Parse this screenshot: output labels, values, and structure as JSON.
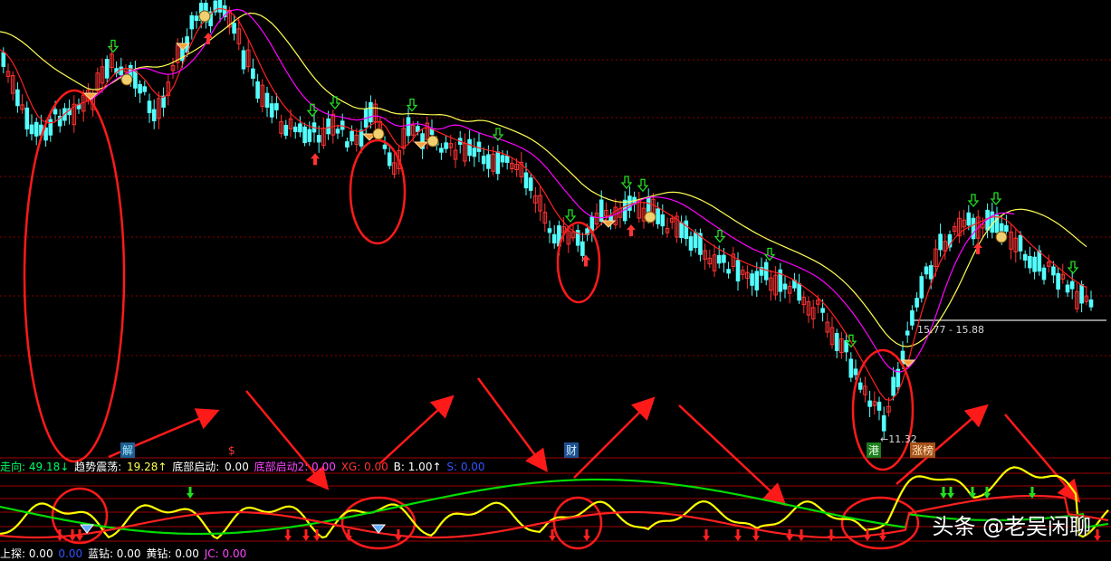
{
  "colors": {
    "up": "#ff3333",
    "down": "#54ffff",
    "ma_yellow": "#ffff55",
    "ma_red": "#ff2020",
    "ma_purple": "#ff00ff",
    "annotation": "#ff1a1a",
    "grid": "#8a0000",
    "osc_green": "#00dd00",
    "osc_yellow": "#ffff00",
    "osc_red": "#ff2020"
  },
  "price_labels": {
    "range": "15.77 - 15.88",
    "low": "←11.32"
  },
  "tags": {
    "jie": "解",
    "dollar": "$",
    "cai": "财",
    "gang": "港",
    "zhangbang": "涨榜"
  },
  "indicator_top": {
    "direction": "走向: 49.18↓",
    "trend_label": "趋势震荡:",
    "trend_value": "19.28↑",
    "bottom_label": "底部启动:",
    "bottom_value": "0.00",
    "bottom2": "底部启动2: 0.00",
    "xg": "XG: 0.00",
    "b": "B: 1.00↑",
    "s": "S: 0.00"
  },
  "indicator_bottom": {
    "upper": "上探: 0.00",
    "unnamed": "0.00",
    "blue_diamond": "蓝钻: 0.00",
    "yellow_diamond": "黄钻: 0.00",
    "jc": "JC: 0.00"
  },
  "watermark": "头条 @老吴闲聊",
  "chart_data": {
    "type": "candlestick",
    "price_annotations": [
      "15.77 - 15.88",
      "←11.32"
    ],
    "price_range_estimate": [
      11.0,
      22.0
    ],
    "panels": [
      "candlestick with moving averages",
      "oscillator"
    ],
    "highlighted_regions": 6,
    "note_signals": [
      "buy arrows",
      "sell arrows",
      "diamond",
      "money bag"
    ]
  }
}
